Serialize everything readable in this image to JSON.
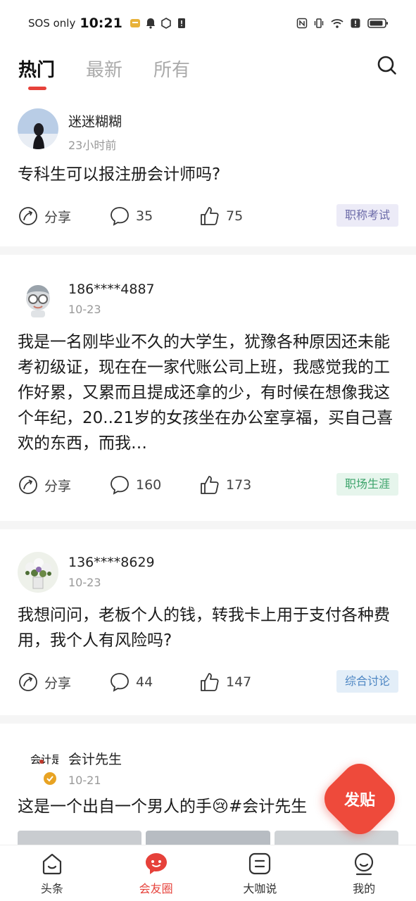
{
  "status_bar": {
    "carrier": "SOS only",
    "time": "10:21",
    "icons": [
      "app-notification-icon",
      "bell-icon",
      "hexagon-icon",
      "sim-alert-icon",
      "nfc-icon",
      "vibrate-icon",
      "wifi-icon",
      "alert-icon",
      "battery-icon"
    ]
  },
  "tabs": [
    {
      "label": "热门",
      "active": true
    },
    {
      "label": "最新",
      "active": false
    },
    {
      "label": "所有",
      "active": false
    }
  ],
  "colors": {
    "accent": "#e6413a",
    "tag_exam_bg": "#ecebf7",
    "tag_exam_fg": "#6b6aa8",
    "tag_career_bg": "#e6f5ec",
    "tag_career_fg": "#3ba36a",
    "tag_discuss_bg": "#e3eef8",
    "tag_discuss_fg": "#4d86c3"
  },
  "posts": [
    {
      "username": "迷迷糊糊",
      "time": "23小时前",
      "content": "专科生可以报注册会计师吗?",
      "share_label": "分享",
      "comments": "35",
      "likes": "75",
      "tag": "职称考试"
    },
    {
      "username": "186****4887",
      "time": "10-23",
      "content": "我是一名刚毕业不久的大学生，犹豫各种原因还未能考初级证，现在在一家代账公司上班，我感觉我的工作好累，又累而且提成还拿的少，有时候在想像我这个年纪，20..21岁的女孩坐在办公室享福，买自己喜欢的东西，而我…",
      "share_label": "分享",
      "comments": "160",
      "likes": "173",
      "tag": "职场生涯"
    },
    {
      "username": "136****8629",
      "time": "10-23",
      "content": "我想问问，老板个人的钱，转我卡上用于支付各种费用，我个人有风险吗?",
      "share_label": "分享",
      "comments": "44",
      "likes": "147",
      "tag": "综合讨论"
    },
    {
      "username": "会计先生",
      "time": "10-21",
      "content": "这是一个出自一个男人的手😢#会计先生",
      "avatar_text": "会计是"
    }
  ],
  "fab_label": "发贴",
  "bottom_nav": [
    {
      "label": "头条",
      "icon": "home-icon",
      "active": false
    },
    {
      "label": "会友圈",
      "icon": "chat-face-icon",
      "active": true
    },
    {
      "label": "大咖说",
      "icon": "talk-icon",
      "active": false
    },
    {
      "label": "我的",
      "icon": "profile-icon",
      "active": false
    }
  ]
}
